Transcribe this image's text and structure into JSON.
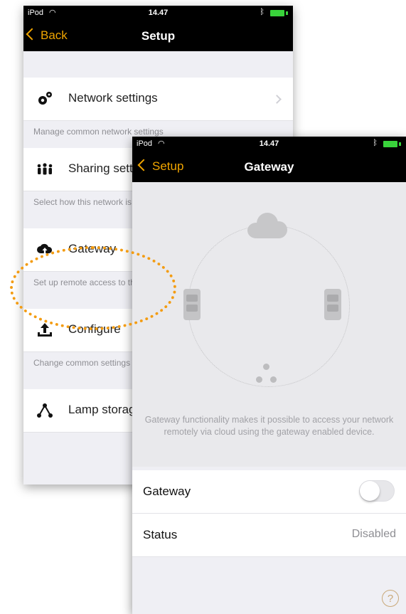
{
  "back_screen": {
    "status": {
      "carrier": "iPod",
      "time": "14.47"
    },
    "nav": {
      "back_label": "Back",
      "title": "Setup"
    },
    "items": [
      {
        "label": "Network settings",
        "desc": "Manage common network settings"
      },
      {
        "label": "Sharing settings",
        "desc": "Select how this network is shared with other mobile devices"
      },
      {
        "label": "Gateway",
        "desc": "Set up remote access to this network via this device."
      },
      {
        "label": "Configure",
        "desc": "Change common settings for the lamps in the network."
      },
      {
        "label": "Lamp storage",
        "desc": ""
      }
    ]
  },
  "front_screen": {
    "status": {
      "carrier": "iPod",
      "time": "14.47"
    },
    "nav": {
      "back_label": "Setup",
      "title": "Gateway"
    },
    "description": "Gateway functionality makes it possible to access your network remotely via cloud using the gateway enabled device.",
    "rows": [
      {
        "label": "Gateway",
        "toggle": "off"
      },
      {
        "label": "Status",
        "value": "Disabled"
      }
    ],
    "help_label": "?"
  },
  "colors": {
    "accent": "#f0a500",
    "highlight": "#f39c12",
    "battery": "#39d33b"
  },
  "icons": [
    "gears-icon",
    "people-icon",
    "cloud-upload-icon",
    "upload-icon",
    "lamp-storage-icon",
    "cloud-icon",
    "mobile-device-icon",
    "hub-icon",
    "help-icon",
    "wifi-icon",
    "bluetooth-icon",
    "battery-icon"
  ]
}
